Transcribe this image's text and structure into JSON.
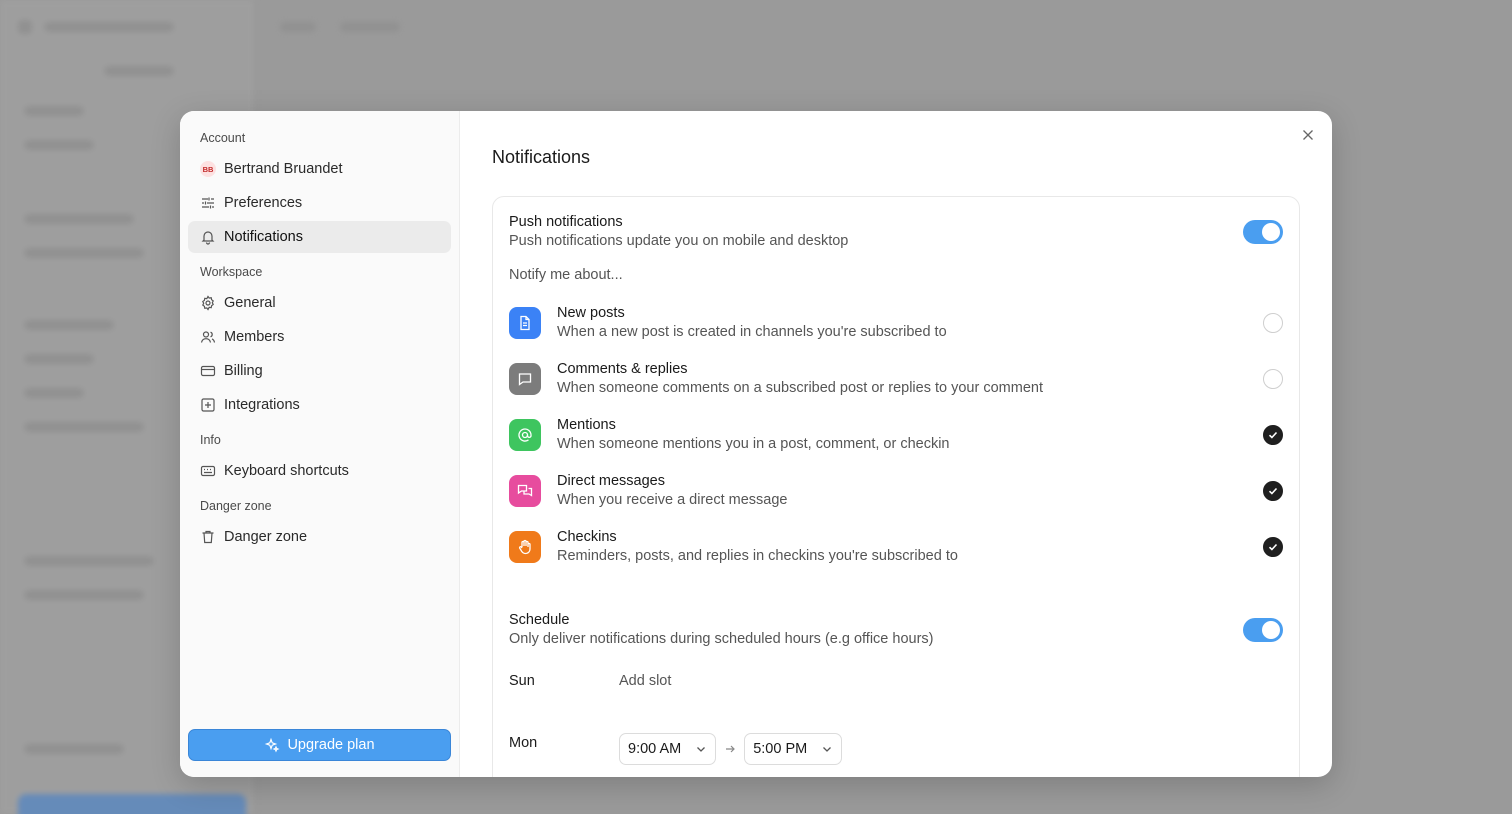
{
  "sidebar": {
    "account_label": "Account",
    "user_initials": "BB",
    "user_name": "Bertrand Bruandet",
    "preferences": "Preferences",
    "notifications": "Notifications",
    "workspace_label": "Workspace",
    "general": "General",
    "members": "Members",
    "billing": "Billing",
    "integrations": "Integrations",
    "info_label": "Info",
    "keyboard_shortcuts": "Keyboard shortcuts",
    "danger_label": "Danger zone",
    "danger_zone": "Danger zone",
    "upgrade": "Upgrade plan"
  },
  "main": {
    "title": "Notifications",
    "push": {
      "title": "Push notifications",
      "subtitle": "Push notifications update you on mobile and desktop",
      "enabled": true
    },
    "notify_label": "Notify me about...",
    "items": [
      {
        "title": "New posts",
        "desc": "When a new post is created in channels you're subscribed to",
        "checked": false,
        "icon": "document-icon",
        "color": "#3b82f6"
      },
      {
        "title": "Comments & replies",
        "desc": "When someone comments on a subscribed post or replies to your comment",
        "checked": false,
        "icon": "comment-icon",
        "color": "#7c7c7c"
      },
      {
        "title": "Mentions",
        "desc": "When someone mentions you in a post, comment, or checkin",
        "checked": true,
        "icon": "at-icon",
        "color": "#3ec55f"
      },
      {
        "title": "Direct messages",
        "desc": "When you receive a direct message",
        "checked": true,
        "icon": "messages-icon",
        "color": "#e74c9e"
      },
      {
        "title": "Checkins",
        "desc": "Reminders, posts, and replies in checkins you're subscribed to",
        "checked": true,
        "icon": "hand-icon",
        "color": "#f07a1a"
      }
    ],
    "schedule": {
      "title": "Schedule",
      "subtitle": "Only deliver notifications during scheduled hours (e.g office hours)",
      "enabled": true
    },
    "days": {
      "sun": "Sun",
      "add_slot": "Add slot",
      "mon": "Mon",
      "mon_start": "9:00 AM",
      "mon_end": "5:00 PM"
    }
  }
}
